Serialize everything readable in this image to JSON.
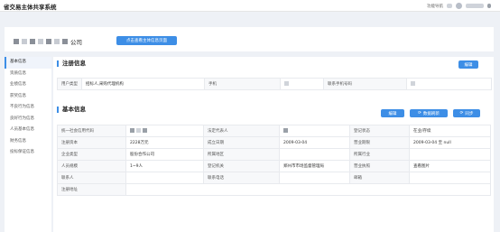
{
  "header": {
    "title": "省交易主体共享系统",
    "feature_link": "功能导航"
  },
  "company": {
    "name_suffix": "公司",
    "view_info_button": "点击查看主体信息页面"
  },
  "sidebar": {
    "items": [
      {
        "label": "基本信息"
      },
      {
        "label": "资质信息"
      },
      {
        "label": "业绩信息"
      },
      {
        "label": "获奖信息"
      },
      {
        "label": "不良行为信息"
      },
      {
        "label": "良好行为信息"
      },
      {
        "label": "人员基本信息"
      },
      {
        "label": "财务信息"
      },
      {
        "label": "投标保证信息"
      }
    ]
  },
  "registration": {
    "title": "注册信息",
    "edit_button": "编辑",
    "row": {
      "user_type_label": "用户类型",
      "user_type_value": "招标人,采购代理机构",
      "phone_label": "手机",
      "mobile_label": "联系手机号码"
    }
  },
  "basic": {
    "title": "基本信息",
    "edit_button": "编辑",
    "refresh_button": "数据刷新",
    "sync_button": "同步",
    "rows": [
      {
        "l1": "统一社会信用代码",
        "v1": "",
        "l2": "法定代表人",
        "v2": "",
        "l3": "登记状态",
        "v3": "在业/存续"
      },
      {
        "l1": "注册资本",
        "v1": "2228万元",
        "l2": "成立日期",
        "v2": "2009-03-04",
        "l3": "营业期限",
        "v3": "2009-03-04 至 null"
      },
      {
        "l1": "企业类型",
        "v1": "股份合作公司",
        "l2": "所属地区",
        "v2": "",
        "l3": "所属行业",
        "v3": ""
      },
      {
        "l1": "人员规模",
        "v1": "1~9人",
        "l2": "登记机关",
        "v2": "郑州市市场监督管理局",
        "l3": "营业执照",
        "v3": "查看图片"
      },
      {
        "l1": "联系人",
        "v1": "",
        "l2": "联系电话",
        "v2": "",
        "l3": "邮箱",
        "v3": ""
      },
      {
        "l1": "注册地址",
        "v1": "",
        "l2": "",
        "v2": "",
        "l3": "",
        "v3": ""
      }
    ]
  },
  "colors": {
    "accent": "#3d8ee6",
    "background": "#eef1f6"
  }
}
